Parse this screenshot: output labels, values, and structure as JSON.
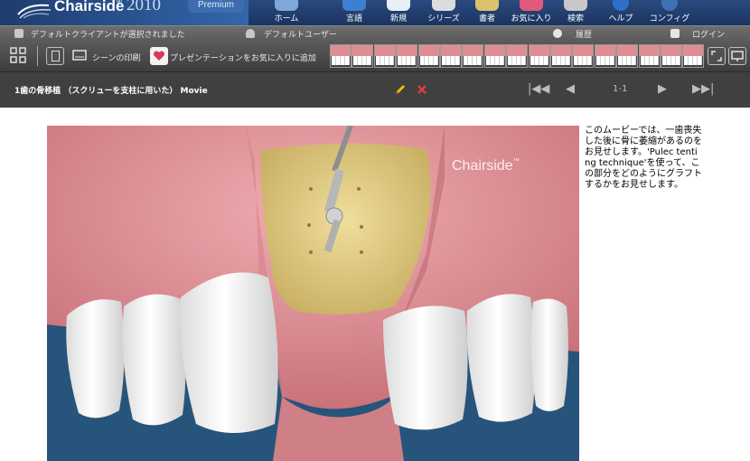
{
  "header": {
    "brand": "Chairside",
    "tm": "®",
    "year": "2010",
    "edition": "Premium",
    "tools": [
      {
        "label": "ホーム",
        "icon": "home-icon"
      },
      {
        "label": "言語",
        "icon": "language-icon"
      },
      {
        "label": "新規",
        "icon": "new-icon"
      },
      {
        "label": "シリーズ",
        "icon": "series-icon"
      },
      {
        "label": "書者",
        "icon": "book-icon"
      },
      {
        "label": "お気に入り",
        "icon": "favorites-icon"
      },
      {
        "label": "検索",
        "icon": "search-icon"
      },
      {
        "label": "ヘルプ",
        "icon": "help-icon"
      },
      {
        "label": "コンフィグ",
        "icon": "config-icon"
      }
    ]
  },
  "status": {
    "client": "デフォルトクライアントが選択されました",
    "user": "デフォルトユーザー",
    "history": "履歴",
    "login": "ログイン"
  },
  "presentation": {
    "print_scene": "シーンの印刷",
    "add_favorite": "プレゼンテーションをお気に入りに追加",
    "thumbnail_count": 17
  },
  "movie": {
    "title": "1歯の骨移植 （スクリューを支柱に用いた） Movie",
    "page": "1-1",
    "watermark": "Chairside",
    "watermark_tm": "™",
    "caption": "このムービーでは、一歯喪失した後に骨に萎縮があるのをお見せします。'Pulec tenting technique'を使って、この部分をどのようにグラフトするかをお見せします。"
  },
  "colors": {
    "header_blue": "#1e3c6e",
    "gum_pink": "#de8e93",
    "bone_yellow": "#e6d186",
    "movie_background": "#27547a"
  }
}
